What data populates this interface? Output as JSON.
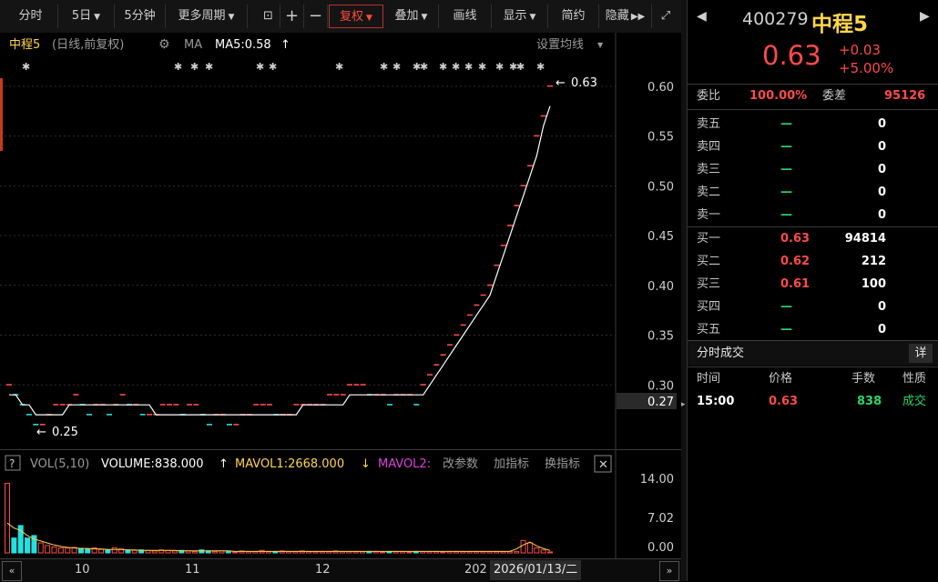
{
  "toolbar": {
    "items": [
      "分时",
      "5日",
      "5分钟",
      "更多周期",
      "复权",
      "叠加",
      "画线",
      "显示",
      "简约",
      "隐藏"
    ]
  },
  "chart_header": {
    "name": "中程5",
    "subtitle": "(日线,前复权)",
    "ma_label": "MA",
    "ma5": "MA5:0.58",
    "settings": "设置均线"
  },
  "annotations": {
    "high": "0.63",
    "low": "0.25"
  },
  "chart_data": [
    {
      "type": "candlestick",
      "y_ticks": [
        "0.60",
        "0.55",
        "0.50",
        "0.45",
        "0.40",
        "0.35",
        "0.30",
        "0.27"
      ],
      "ylim": [
        0.25,
        0.63
      ],
      "x_tick_labels": [
        "10",
        "11",
        "12",
        "202",
        "2026/01/13/二"
      ],
      "closes": [
        0.3,
        0.29,
        0.28,
        0.27,
        0.26,
        0.26,
        0.27,
        0.28,
        0.28,
        0.28,
        0.29,
        0.28,
        0.27,
        0.28,
        0.28,
        0.27,
        0.28,
        0.29,
        0.28,
        0.28,
        0.27,
        0.27,
        0.27,
        0.28,
        0.28,
        0.28,
        0.27,
        0.28,
        0.28,
        0.27,
        0.26,
        0.27,
        0.27,
        0.26,
        0.26,
        0.27,
        0.27,
        0.28,
        0.28,
        0.28,
        0.27,
        0.27,
        0.27,
        0.28,
        0.28,
        0.28,
        0.28,
        0.28,
        0.29,
        0.29,
        0.29,
        0.3,
        0.3,
        0.3,
        0.29,
        0.29,
        0.29,
        0.28,
        0.29,
        0.29,
        0.29,
        0.28,
        0.3,
        0.31,
        0.32,
        0.33,
        0.34,
        0.35,
        0.36,
        0.37,
        0.38,
        0.39,
        0.4,
        0.42,
        0.44,
        0.46,
        0.48,
        0.5,
        0.52,
        0.55,
        0.57,
        0.6
      ],
      "ma5": [
        0.29,
        0.29,
        0.28,
        0.28,
        0.27,
        0.27,
        0.27,
        0.27,
        0.27,
        0.28,
        0.28,
        0.28,
        0.28,
        0.28,
        0.28,
        0.28,
        0.28,
        0.28,
        0.28,
        0.28,
        0.28,
        0.28,
        0.27,
        0.27,
        0.27,
        0.27,
        0.27,
        0.27,
        0.27,
        0.27,
        0.27,
        0.27,
        0.27,
        0.27,
        0.27,
        0.27,
        0.27,
        0.27,
        0.27,
        0.27,
        0.27,
        0.27,
        0.27,
        0.27,
        0.28,
        0.28,
        0.28,
        0.28,
        0.28,
        0.28,
        0.28,
        0.29,
        0.29,
        0.29,
        0.29,
        0.29,
        0.29,
        0.29,
        0.29,
        0.29,
        0.29,
        0.29,
        0.29,
        0.3,
        0.31,
        0.32,
        0.33,
        0.34,
        0.35,
        0.36,
        0.37,
        0.38,
        0.39,
        0.41,
        0.43,
        0.45,
        0.47,
        0.49,
        0.51,
        0.53,
        0.56,
        0.58
      ]
    },
    {
      "type": "bar",
      "title": "VOL(5,10)",
      "volume": "VOLUME:838.000",
      "mavol1": "MAVOL1:2668.000",
      "mavol2": "MAVOL2:",
      "y_ticks": [
        "14.00",
        "7.02",
        "0.00"
      ],
      "ylim": [
        0,
        15
      ],
      "values": [
        14.0,
        3.0,
        5.5,
        3.0,
        3.5,
        2.0,
        1.5,
        1.2,
        1.0,
        1.0,
        1.1,
        0.9,
        0.8,
        1.0,
        0.7,
        0.6,
        1.0,
        0.8,
        0.6,
        0.5,
        0.6,
        0.5,
        0.4,
        0.6,
        0.5,
        0.4,
        0.5,
        0.4,
        0.3,
        0.6,
        0.4,
        0.3,
        0.4,
        0.3,
        0.2,
        0.4,
        0.3,
        0.3,
        0.5,
        0.3,
        0.3,
        0.4,
        0.3,
        0.3,
        0.4,
        0.3,
        0.3,
        0.3,
        0.3,
        0.4,
        0.3,
        0.3,
        0.3,
        0.3,
        0.3,
        0.3,
        0.2,
        0.3,
        0.3,
        0.3,
        0.2,
        0.3,
        0.3,
        0.3,
        0.3,
        0.2,
        0.3,
        0.3,
        0.3,
        0.3,
        0.3,
        0.3,
        0.3,
        0.3,
        0.3,
        0.3,
        0.3,
        2.5,
        2.0,
        1.0,
        0.6,
        0.2
      ],
      "mavol1_line": [
        6.0,
        5.0,
        4.5,
        3.5,
        2.8,
        2.4,
        2.0,
        1.6,
        1.3,
        1.1,
        1.0,
        0.9,
        0.9,
        0.8,
        0.8,
        0.7,
        0.7,
        0.7,
        0.6,
        0.6,
        0.5,
        0.5,
        0.5,
        0.5,
        0.5,
        0.5,
        0.4,
        0.4,
        0.4,
        0.4,
        0.4,
        0.4,
        0.4,
        0.4,
        0.3,
        0.3,
        0.3,
        0.3,
        0.3,
        0.3,
        0.3,
        0.3,
        0.3,
        0.3,
        0.3,
        0.3,
        0.3,
        0.3,
        0.3,
        0.3,
        0.3,
        0.3,
        0.3,
        0.3,
        0.3,
        0.3,
        0.3,
        0.3,
        0.3,
        0.3,
        0.3,
        0.3,
        0.3,
        0.3,
        0.3,
        0.3,
        0.3,
        0.3,
        0.3,
        0.3,
        0.3,
        0.3,
        0.3,
        0.3,
        0.3,
        0.3,
        0.8,
        1.6,
        2.2,
        1.4,
        0.9,
        0.5
      ]
    }
  ],
  "vol_tools": [
    "改参数",
    "加指标",
    "换指标"
  ],
  "quote": {
    "code": "400279",
    "name": "中程5",
    "price": "0.63",
    "change": "+0.03",
    "pct": "+5.00%",
    "weibi_label": "委比",
    "weibi": "100.00%",
    "weicha_label": "委差",
    "weicha": "95126",
    "asks": [
      {
        "label": "卖五",
        "price": "—",
        "vol": "0"
      },
      {
        "label": "卖四",
        "price": "—",
        "vol": "0"
      },
      {
        "label": "卖三",
        "price": "—",
        "vol": "0"
      },
      {
        "label": "卖二",
        "price": "—",
        "vol": "0"
      },
      {
        "label": "卖一",
        "price": "—",
        "vol": "0"
      }
    ],
    "bids": [
      {
        "label": "买一",
        "price": "0.63",
        "vol": "94814"
      },
      {
        "label": "买二",
        "price": "0.62",
        "vol": "212"
      },
      {
        "label": "买三",
        "price": "0.61",
        "vol": "100"
      },
      {
        "label": "买四",
        "price": "—",
        "vol": "0"
      },
      {
        "label": "买五",
        "price": "—",
        "vol": "0"
      }
    ],
    "trades_title": "分时成交",
    "detail_btn": "详",
    "trade_headers": [
      "时间",
      "价格",
      "手数",
      "性质"
    ],
    "trades": [
      {
        "time": "15:00",
        "price": "0.63",
        "qty": "838",
        "type": "成交"
      }
    ]
  },
  "colors": {
    "up": "#ff4a4a",
    "down": "#24e0e0",
    "ma5": "#ffffff",
    "mavol1": "#ffd54a",
    "mavol2": "#e040e0"
  }
}
